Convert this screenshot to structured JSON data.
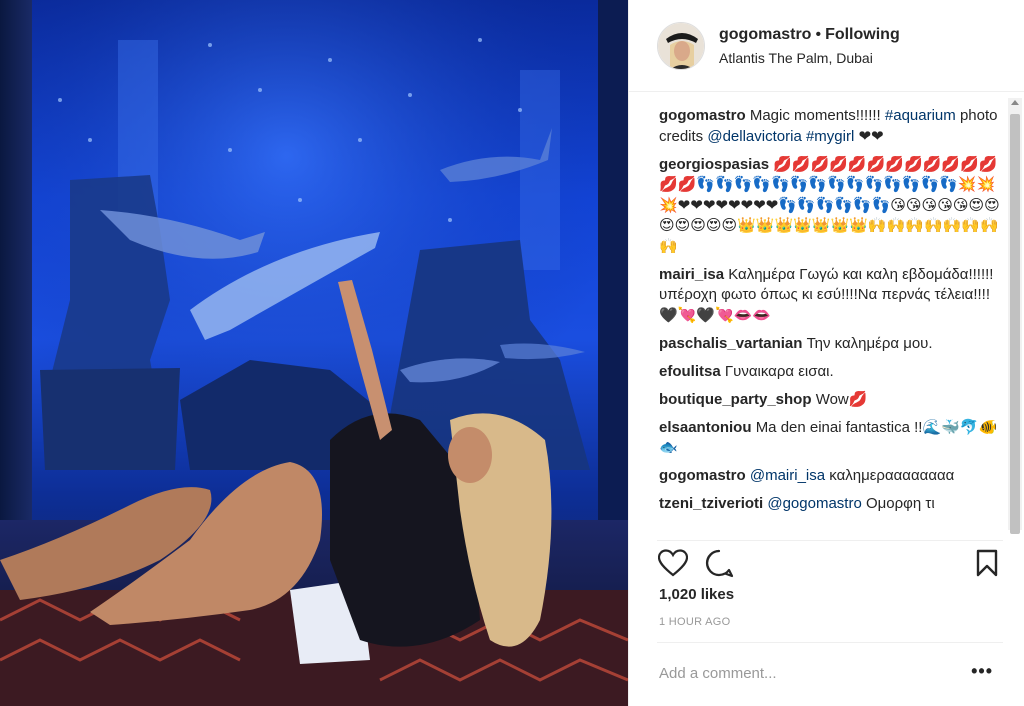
{
  "post": {
    "username": "gogomastro",
    "separator": "•",
    "follow_status": "Following",
    "location": "Atlantis The Palm, Dubai",
    "likes": "1,020 likes",
    "time": "1 HOUR AGO",
    "add_comment_placeholder": "Add a comment...",
    "more_label": "•••"
  },
  "comments": [
    {
      "user": "gogomastro",
      "parts": [
        {
          "t": "text",
          "v": "Magic moments!!!!!! "
        },
        {
          "t": "tag",
          "v": "#aquarium"
        },
        {
          "t": "text",
          "v": " photo credits "
        },
        {
          "t": "tag",
          "v": "@dellavictoria"
        },
        {
          "t": "text",
          "v": " "
        },
        {
          "t": "tag",
          "v": "#mygirl"
        },
        {
          "t": "text",
          "v": " ❤❤"
        }
      ]
    },
    {
      "user": "georgiospasias",
      "parts": [
        {
          "t": "text",
          "v": "💋💋💋💋💋💋💋💋💋💋💋💋💋💋👣👣👣👣👣👣👣👣👣👣👣👣👣👣💥💥💥❤❤❤❤❤❤❤❤👣👣👣👣👣👣😘😘😘😘😘😍😍😍😍😍😍😍👑👑👑👑👑👑👑🙌🙌🙌🙌🙌🙌🙌🙌"
        }
      ]
    },
    {
      "user": "mairi_isa",
      "parts": [
        {
          "t": "text",
          "v": "Καλημέρα Γωγώ και καλη εβδομάδα!!!!!!υπέροχη φωτο όπως κι εσύ!!!!Να περνάς τέλεια!!!!🖤💘🖤💘👄👄"
        }
      ]
    },
    {
      "user": "paschalis_vartanian",
      "parts": [
        {
          "t": "text",
          "v": "Την καλημέρα μου."
        }
      ]
    },
    {
      "user": "efoulitsa",
      "parts": [
        {
          "t": "text",
          "v": "Γυναικαρα εισαι."
        }
      ]
    },
    {
      "user": "boutique_party_shop",
      "parts": [
        {
          "t": "text",
          "v": "Wow💋"
        }
      ]
    },
    {
      "user": "elsaantoniou",
      "parts": [
        {
          "t": "text",
          "v": "Ma den einai fantastica !!🌊🐳🐬🐠🐟"
        }
      ]
    },
    {
      "user": "gogomastro",
      "parts": [
        {
          "t": "tag",
          "v": "@mairi_isa"
        },
        {
          "t": "text",
          "v": " καλημεραααααααα"
        }
      ]
    },
    {
      "user": "tzeni_tziverioti",
      "parts": [
        {
          "t": "tag",
          "v": "@gogomastro"
        },
        {
          "t": "text",
          "v": " Ομορφη τι"
        }
      ]
    }
  ],
  "icons": {
    "like": "heart-icon",
    "comment": "comment-bubble-icon",
    "save": "bookmark-icon"
  },
  "colors": {
    "link": "#003569",
    "text": "#262626",
    "muted": "#999999",
    "heart_emoji": "#ed4956"
  }
}
